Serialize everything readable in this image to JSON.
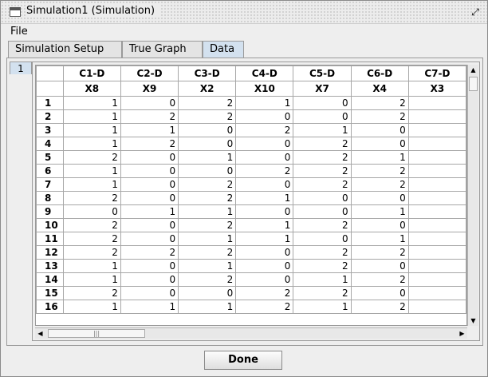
{
  "window": {
    "title": "Simulation1 (Simulation)"
  },
  "menu": {
    "file": "File"
  },
  "tabs": [
    "Simulation Setup",
    "True Graph",
    "Data"
  ],
  "subtab": "1",
  "table": {
    "columns": [
      {
        "name": "C1-D",
        "var": "X8"
      },
      {
        "name": "C2-D",
        "var": "X9"
      },
      {
        "name": "C3-D",
        "var": "X2"
      },
      {
        "name": "C4-D",
        "var": "X10"
      },
      {
        "name": "C5-D",
        "var": "X7"
      },
      {
        "name": "C6-D",
        "var": "X4"
      },
      {
        "name": "C7-D",
        "var": "X3"
      }
    ],
    "rows": [
      {
        "label": "1",
        "values": [
          "1",
          "0",
          "2",
          "1",
          "0",
          "2",
          ""
        ]
      },
      {
        "label": "2",
        "values": [
          "1",
          "2",
          "2",
          "0",
          "0",
          "2",
          ""
        ]
      },
      {
        "label": "3",
        "values": [
          "1",
          "1",
          "0",
          "2",
          "1",
          "0",
          ""
        ]
      },
      {
        "label": "4",
        "values": [
          "1",
          "2",
          "0",
          "0",
          "2",
          "0",
          ""
        ]
      },
      {
        "label": "5",
        "values": [
          "2",
          "0",
          "1",
          "0",
          "2",
          "1",
          ""
        ]
      },
      {
        "label": "6",
        "values": [
          "1",
          "0",
          "0",
          "2",
          "2",
          "2",
          ""
        ]
      },
      {
        "label": "7",
        "values": [
          "1",
          "0",
          "2",
          "0",
          "2",
          "2",
          ""
        ]
      },
      {
        "label": "8",
        "values": [
          "2",
          "0",
          "2",
          "1",
          "0",
          "0",
          ""
        ]
      },
      {
        "label": "9",
        "values": [
          "0",
          "1",
          "1",
          "0",
          "0",
          "1",
          ""
        ]
      },
      {
        "label": "10",
        "values": [
          "2",
          "0",
          "2",
          "1",
          "2",
          "0",
          ""
        ]
      },
      {
        "label": "11",
        "values": [
          "2",
          "0",
          "1",
          "1",
          "0",
          "1",
          ""
        ]
      },
      {
        "label": "12",
        "values": [
          "2",
          "2",
          "2",
          "0",
          "2",
          "2",
          ""
        ]
      },
      {
        "label": "13",
        "values": [
          "1",
          "0",
          "1",
          "0",
          "2",
          "0",
          ""
        ]
      },
      {
        "label": "14",
        "values": [
          "1",
          "0",
          "2",
          "0",
          "1",
          "2",
          ""
        ]
      },
      {
        "label": "15",
        "values": [
          "2",
          "0",
          "0",
          "2",
          "2",
          "0",
          ""
        ]
      },
      {
        "label": "16",
        "values": [
          "1",
          "1",
          "1",
          "2",
          "1",
          "2",
          ""
        ]
      }
    ]
  },
  "buttons": {
    "done": "Done"
  }
}
